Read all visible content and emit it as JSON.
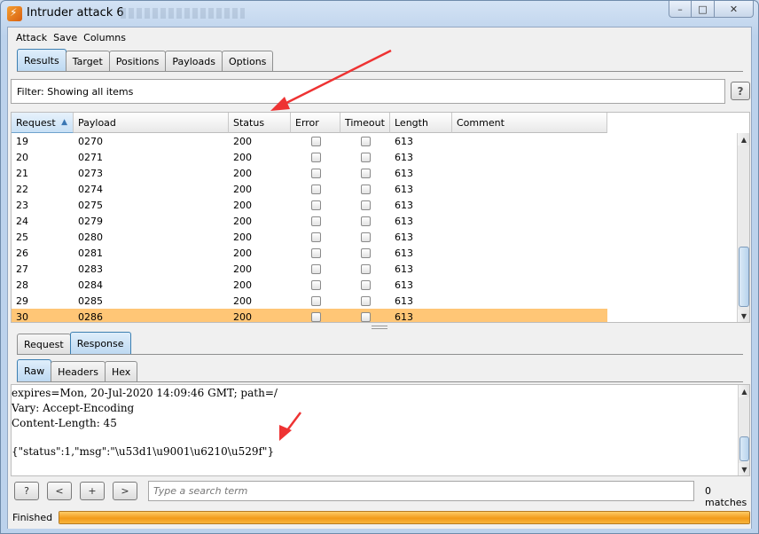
{
  "window": {
    "title": "Intruder attack 6",
    "min_label": "–",
    "max_label": "□",
    "close_label": "✕"
  },
  "menu": [
    "Attack",
    "Save",
    "Columns"
  ],
  "main_tabs": [
    {
      "label": "Results",
      "active": true
    },
    {
      "label": "Target",
      "active": false
    },
    {
      "label": "Positions",
      "active": false
    },
    {
      "label": "Payloads",
      "active": false
    },
    {
      "label": "Options",
      "active": false
    }
  ],
  "filter": {
    "text": "Filter: Showing all items",
    "help_label": "?"
  },
  "table": {
    "columns": [
      "Request",
      "Payload",
      "Status",
      "Error",
      "Timeout",
      "Length",
      "Comment"
    ],
    "sort_indicator": "▲",
    "rows": [
      {
        "request": "19",
        "payload": "0270",
        "status": "200",
        "length": "613"
      },
      {
        "request": "20",
        "payload": "0271",
        "status": "200",
        "length": "613"
      },
      {
        "request": "21",
        "payload": "0273",
        "status": "200",
        "length": "613"
      },
      {
        "request": "22",
        "payload": "0274",
        "status": "200",
        "length": "613"
      },
      {
        "request": "23",
        "payload": "0275",
        "status": "200",
        "length": "613"
      },
      {
        "request": "24",
        "payload": "0279",
        "status": "200",
        "length": "613"
      },
      {
        "request": "25",
        "payload": "0280",
        "status": "200",
        "length": "613"
      },
      {
        "request": "26",
        "payload": "0281",
        "status": "200",
        "length": "613"
      },
      {
        "request": "27",
        "payload": "0283",
        "status": "200",
        "length": "613"
      },
      {
        "request": "28",
        "payload": "0284",
        "status": "200",
        "length": "613"
      },
      {
        "request": "29",
        "payload": "0285",
        "status": "200",
        "length": "613"
      },
      {
        "request": "30",
        "payload": "0286",
        "status": "200",
        "length": "613",
        "selected": true
      }
    ]
  },
  "rr_tabs": [
    {
      "label": "Request",
      "active": false
    },
    {
      "label": "Response",
      "active": true
    }
  ],
  "view_tabs": [
    {
      "label": "Raw",
      "active": true
    },
    {
      "label": "Headers",
      "active": false
    },
    {
      "label": "Hex",
      "active": false
    }
  ],
  "response": {
    "lines": [
      "expires=Mon, 20-Jul-2020 14:09:46 GMT; path=/",
      "Vary: Accept-Encoding",
      "Content-Length: 45",
      "",
      "{\"status\":1,\"msg\":\"\\u53d1\\u9001\\u6210\\u529f\"}"
    ]
  },
  "search": {
    "help_label": "?",
    "prev_label": "<",
    "add_label": "+",
    "next_label": ">",
    "placeholder": "Type a search term",
    "matches": "0 matches"
  },
  "status": {
    "text": "Finished",
    "progress": 1.0
  },
  "colors": {
    "selected_row": "#ffc676",
    "progress": "#f29a1a",
    "annotation_arrow": "#ee3333"
  }
}
